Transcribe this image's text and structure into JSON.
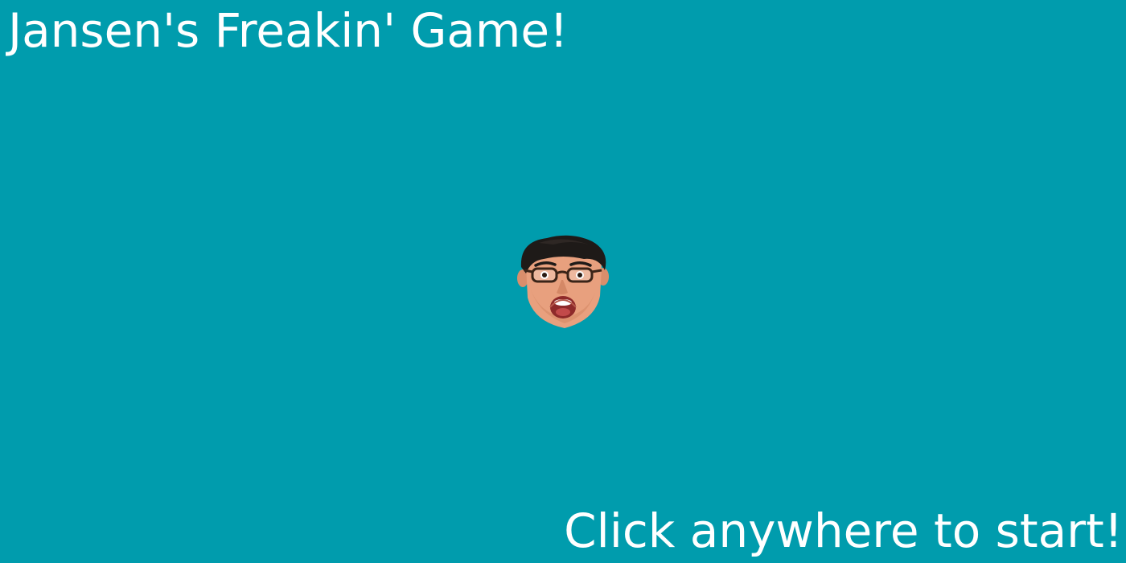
{
  "game": {
    "title": "Jansen's Freakin' Game!",
    "start_prompt": "Click anywhere to start!",
    "player_sprite": "screaming-face-head-icon"
  },
  "colors": {
    "background": "#009CAD",
    "text": "#FFFFFF",
    "skin": "#E8A07E",
    "hair": "#1E1A18",
    "mouth": "#8E2A2A",
    "glasses": "#3A2418"
  }
}
